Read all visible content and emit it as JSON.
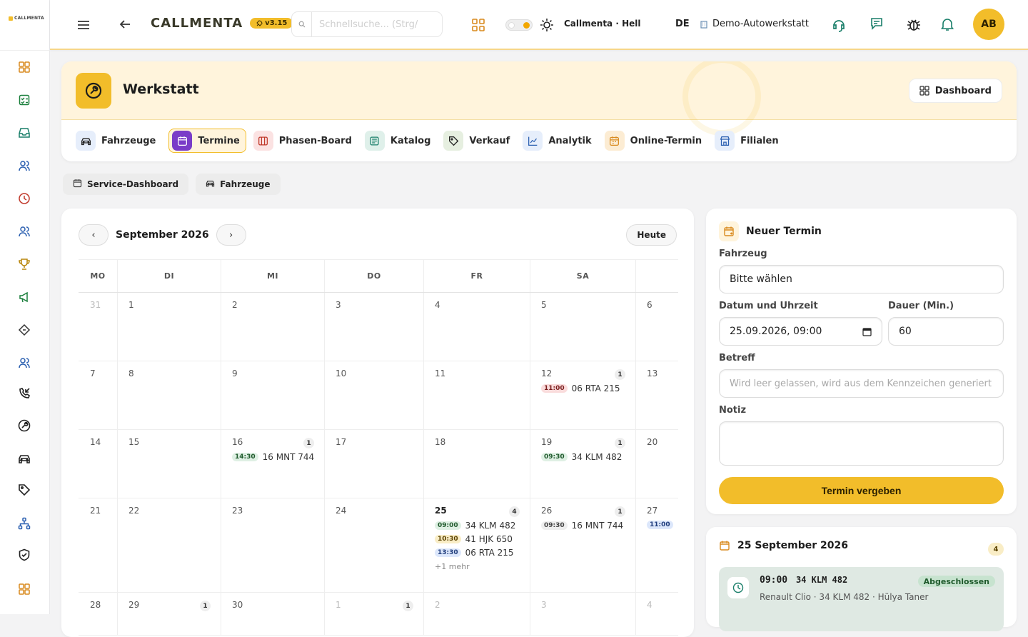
{
  "app": {
    "logo_text": "CALLMENTA",
    "brand": "CALLMENTA",
    "version": "v3.15"
  },
  "topbar": {
    "search_placeholder": "Schnellsuche... (Strg/",
    "theme_label": "Callmenta · Hell",
    "language": "DE",
    "workspace": "Demo-Autowerkstatt",
    "avatar_initials": "AB"
  },
  "rail": {
    "icons": [
      "grid-icon",
      "checklist-icon",
      "inbox-icon",
      "users-icon",
      "clock-icon",
      "team-icon",
      "trophy-icon",
      "megaphone-icon",
      "ticket-icon",
      "contacts-icon",
      "phone-incoming-icon",
      "wrench-icon",
      "car-icon",
      "tag-icon",
      "network-icon",
      "shield-icon",
      "apps-icon"
    ]
  },
  "hero": {
    "title": "Werkstatt",
    "dashboard_label": "Dashboard"
  },
  "tabs": [
    {
      "label": "Fahrzeuge",
      "icon": "car-icon"
    },
    {
      "label": "Termine",
      "icon": "calendar-icon",
      "active": true
    },
    {
      "label": "Phasen-Board",
      "icon": "board-icon"
    },
    {
      "label": "Katalog",
      "icon": "catalog-icon"
    },
    {
      "label": "Verkauf",
      "icon": "tag-icon"
    },
    {
      "label": "Analytik",
      "icon": "chart-icon"
    },
    {
      "label": "Online-Termin",
      "icon": "calendar-online-icon"
    },
    {
      "label": "Filialen",
      "icon": "store-icon"
    }
  ],
  "chips": [
    {
      "label": "Service-Dashboard",
      "icon": "calendar-icon"
    },
    {
      "label": "Fahrzeuge",
      "icon": "car-icon"
    }
  ],
  "calendar": {
    "month_label": "September 2026",
    "prev": "‹",
    "next": "›",
    "today_label": "Heute",
    "weekdays": [
      "MO",
      "DI",
      "MI",
      "DO",
      "FR",
      "SA"
    ],
    "weeks": [
      [
        {
          "d": "31",
          "muted": true
        },
        {
          "d": "1"
        },
        {
          "d": "2"
        },
        {
          "d": "3"
        },
        {
          "d": "4"
        },
        {
          "d": "5"
        },
        {
          "d": "6"
        }
      ],
      [
        {
          "d": "7"
        },
        {
          "d": "8"
        },
        {
          "d": "9"
        },
        {
          "d": "10"
        },
        {
          "d": "11"
        },
        {
          "d": "12",
          "count": "1",
          "events": [
            {
              "time": "11:00",
              "plate": "06 RTA 215",
              "color": "red"
            }
          ]
        },
        {
          "d": "13"
        }
      ],
      [
        {
          "d": "14"
        },
        {
          "d": "15"
        },
        {
          "d": "16",
          "count": "1",
          "events": [
            {
              "time": "14:30",
              "plate": "16 MNT 744",
              "color": "green"
            }
          ]
        },
        {
          "d": "17"
        },
        {
          "d": "18"
        },
        {
          "d": "19",
          "count": "1",
          "events": [
            {
              "time": "09:30",
              "plate": "34 KLM 482",
              "color": "green"
            }
          ]
        },
        {
          "d": "20"
        }
      ],
      [
        {
          "d": "21"
        },
        {
          "d": "22"
        },
        {
          "d": "23"
        },
        {
          "d": "24"
        },
        {
          "d": "25",
          "today": true,
          "count": "4",
          "events": [
            {
              "time": "09:00",
              "plate": "34 KLM 482",
              "color": "green"
            },
            {
              "time": "10:30",
              "plate": "41 HJK 650",
              "color": "yellow"
            },
            {
              "time": "13:30",
              "plate": "06 RTA 215",
              "color": "blue"
            }
          ],
          "more": "+1 mehr"
        },
        {
          "d": "26",
          "count": "1",
          "events": [
            {
              "time": "09:30",
              "plate": "16 MNT 744",
              "color": "grey"
            }
          ]
        },
        {
          "d": "27",
          "events": [
            {
              "time": "11:00",
              "plate": "",
              "color": "blue"
            }
          ]
        }
      ],
      [
        {
          "d": "28"
        },
        {
          "d": "29",
          "count": "1"
        },
        {
          "d": "30"
        },
        {
          "d": "1",
          "muted": true,
          "count": "1"
        },
        {
          "d": "2",
          "muted": true
        },
        {
          "d": "3",
          "muted": true
        },
        {
          "d": "4",
          "muted": true
        }
      ]
    ]
  },
  "new_appointment": {
    "title": "Neuer Termin",
    "vehicle_label": "Fahrzeug",
    "vehicle_value": "Bitte wählen",
    "datetime_label": "Datum und Uhrzeit",
    "datetime_value": "25.09.2026, 09:00",
    "duration_label": "Dauer (Min.)",
    "duration_value": "60",
    "subject_label": "Betreff",
    "subject_placeholder": "Wird leer gelassen, wird aus dem Kennzeichen generiert",
    "note_label": "Notiz",
    "submit_label": "Termin vergeben"
  },
  "day_panel": {
    "title": "25 September 2026",
    "count": "4",
    "appointment": {
      "time": "09:00",
      "plate": "34 KLM 482",
      "subtitle": "Renault Clio · 34 KLM 482 · Hülya Taner",
      "status": "Abgeschlossen"
    }
  }
}
